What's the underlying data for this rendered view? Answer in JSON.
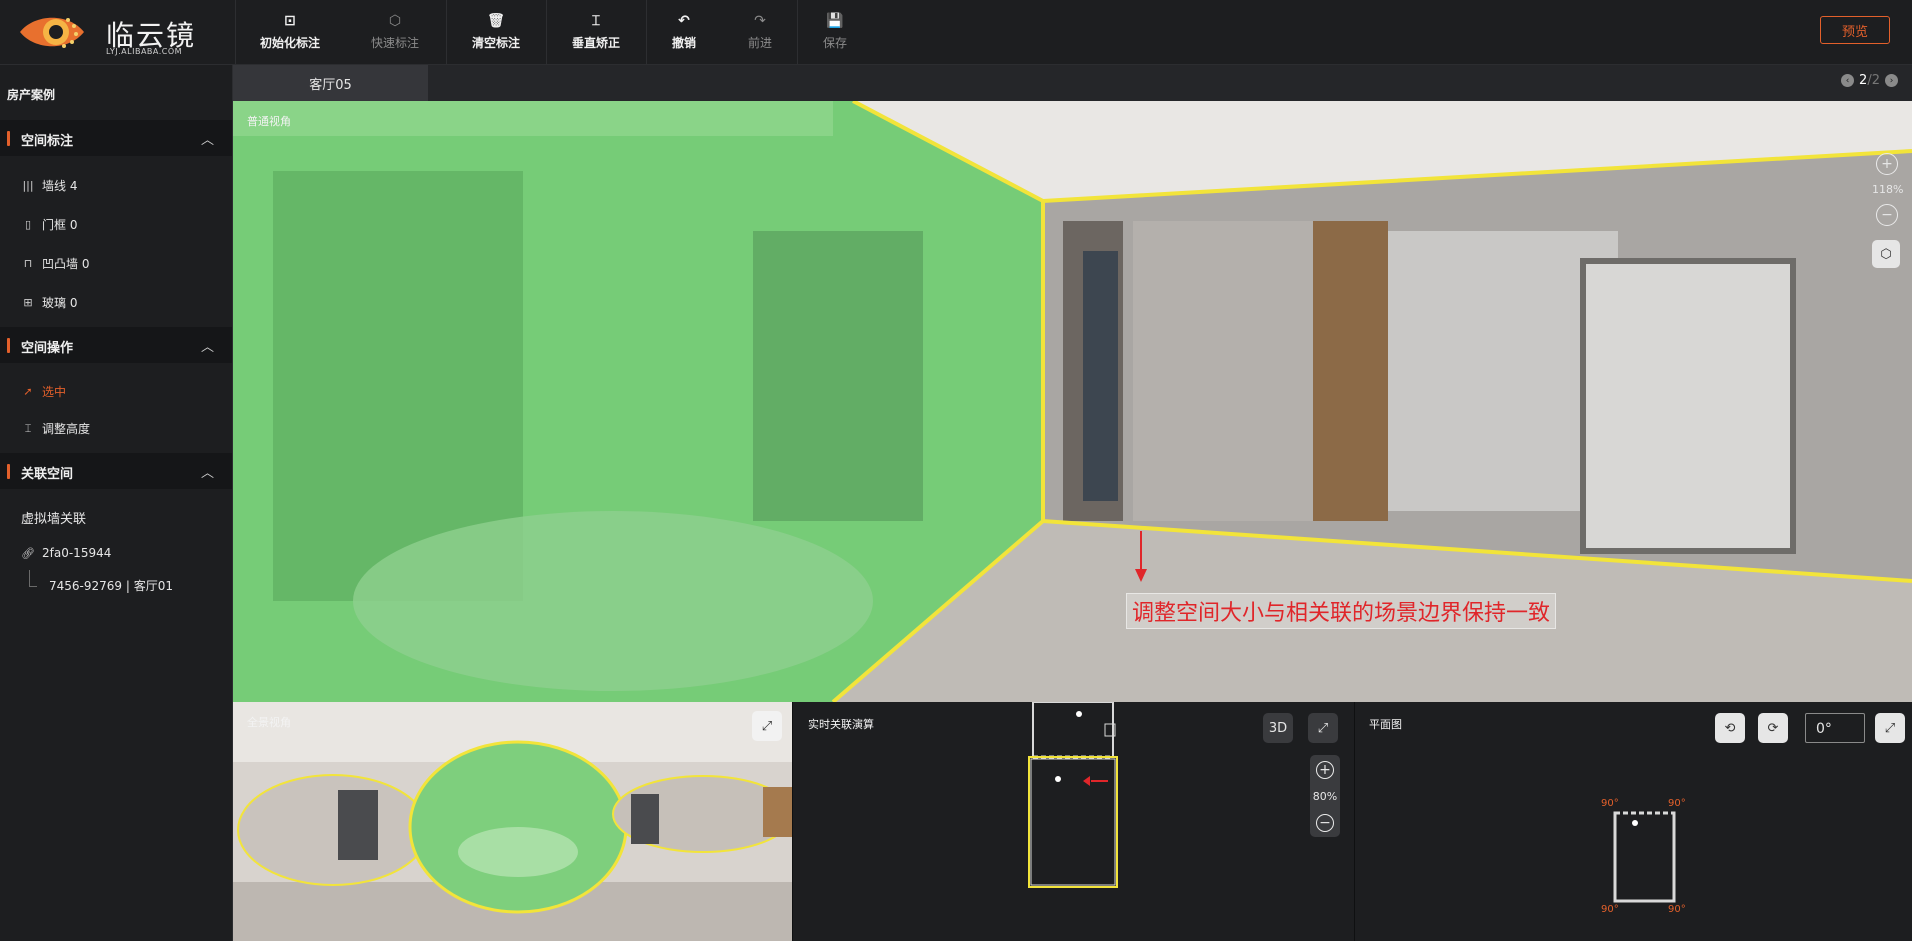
{
  "logo": {
    "text": "临云镜",
    "sub": "LYJ.ALIBABA.COM"
  },
  "toolbar": {
    "init": "初始化标注",
    "quick": "快速标注",
    "clear": "清空标注",
    "vertical": "垂直矫正",
    "undo": "撤销",
    "redo": "前进",
    "save": "保存",
    "preview": "预览"
  },
  "sidebar": {
    "title": "房产案例",
    "sections": {
      "annotation": {
        "label": "空间标注",
        "items": [
          "墙线 4",
          "门框 0",
          "凹凸墙 0",
          "玻璃 0"
        ]
      },
      "operation": {
        "label": "空间操作",
        "items": [
          "选中",
          "调整高度"
        ]
      },
      "related": {
        "label": "关联空间",
        "subtitle": "虚拟墙关联",
        "link": "2fa0-15944",
        "child": "7456-92769 | 客厅01"
      }
    }
  },
  "tab": {
    "name": "客厅05",
    "page_current": "2",
    "page_sep": "/",
    "page_total": "2"
  },
  "main": {
    "label": "普通视角",
    "zoom": "118%",
    "annotation": "调整空间大小与相关联的场景边界保持一致"
  },
  "panorama": {
    "label": "全景视角"
  },
  "realtime": {
    "label": "实时关联演算",
    "mode": "3D",
    "zoom": "80%"
  },
  "floorplan": {
    "label": "平面图",
    "rotation": "0°",
    "corner": "90°"
  },
  "colors": {
    "accent": "#e3602b",
    "highlight": "#f2e43a",
    "annotation": "#e0262a",
    "overlay": "#79d27a"
  }
}
